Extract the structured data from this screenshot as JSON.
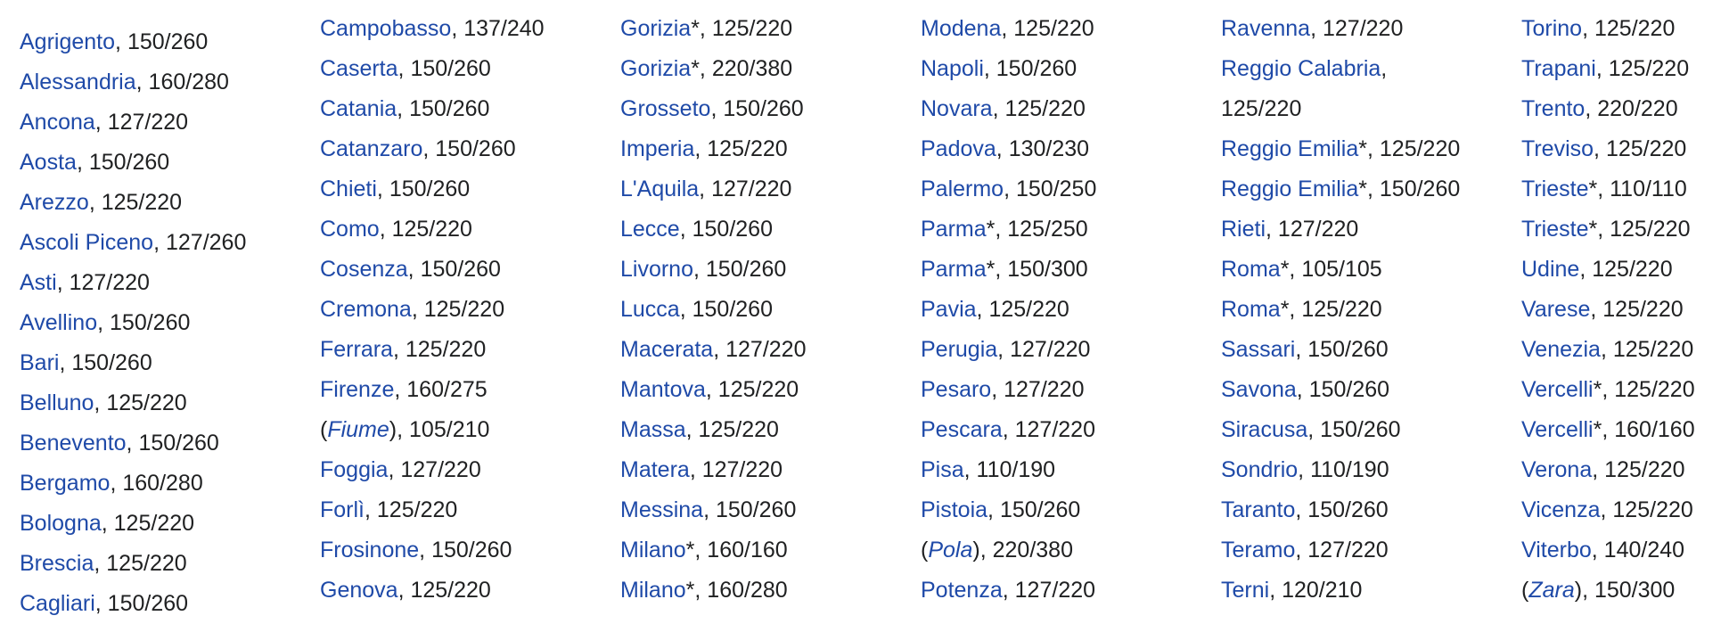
{
  "columns": [
    {
      "entries": [
        {
          "name": "Agrigento",
          "value": "150/260"
        },
        {
          "name": "Alessandria",
          "value": "160/280"
        },
        {
          "name": "Ancona",
          "value": "127/220"
        },
        {
          "name": "Aosta",
          "value": "150/260"
        },
        {
          "name": "Arezzo",
          "value": "125/220"
        },
        {
          "name": "Ascoli Piceno",
          "value": "127/260"
        },
        {
          "name": "Asti",
          "value": "127/220"
        },
        {
          "name": "Avellino",
          "value": "150/260"
        },
        {
          "name": "Bari",
          "value": "150/260"
        },
        {
          "name": "Belluno",
          "value": "125/220"
        },
        {
          "name": "Benevento",
          "value": "150/260"
        },
        {
          "name": "Bergamo",
          "value": "160/280"
        },
        {
          "name": "Bologna",
          "value": "125/220"
        },
        {
          "name": "Brescia",
          "value": "125/220"
        },
        {
          "name": "Cagliari",
          "value": "150/260"
        }
      ]
    },
    {
      "entries": [
        {
          "name": "Campobasso",
          "value": "137/240"
        },
        {
          "name": "Caserta",
          "value": "150/260"
        },
        {
          "name": "Catania",
          "value": "150/260"
        },
        {
          "name": "Catanzaro",
          "value": "150/260"
        },
        {
          "name": "Chieti",
          "value": "150/260"
        },
        {
          "name": "Como",
          "value": "125/220"
        },
        {
          "name": "Cosenza",
          "value": "150/260"
        },
        {
          "name": "Cremona",
          "value": "125/220"
        },
        {
          "name": "Ferrara",
          "value": "125/220"
        },
        {
          "name": "Firenze",
          "value": "160/275"
        },
        {
          "name": "Fiume",
          "value": "105/210",
          "italic": true
        },
        {
          "name": "Foggia",
          "value": "127/220"
        },
        {
          "name": "Forlì",
          "value": "125/220"
        },
        {
          "name": "Frosinone",
          "value": "150/260"
        },
        {
          "name": "Genova",
          "value": "125/220"
        }
      ]
    },
    {
      "entries": [
        {
          "name": "Gorizia",
          "value": "125/220",
          "star": true
        },
        {
          "name": "Gorizia",
          "value": "220/380",
          "star": true
        },
        {
          "name": "Grosseto",
          "value": "150/260"
        },
        {
          "name": "Imperia",
          "value": "125/220"
        },
        {
          "name": "L'Aquila",
          "value": "127/220"
        },
        {
          "name": "Lecce",
          "value": "150/260"
        },
        {
          "name": "Livorno",
          "value": "150/260"
        },
        {
          "name": "Lucca",
          "value": "150/260"
        },
        {
          "name": "Macerata",
          "value": "127/220"
        },
        {
          "name": "Mantova",
          "value": "125/220"
        },
        {
          "name": "Massa",
          "value": "125/220"
        },
        {
          "name": "Matera",
          "value": "127/220"
        },
        {
          "name": "Messina",
          "value": "150/260"
        },
        {
          "name": "Milano",
          "value": "160/160",
          "star": true
        },
        {
          "name": "Milano",
          "value": "160/280",
          "star": true
        }
      ]
    },
    {
      "entries": [
        {
          "name": "Modena",
          "value": "125/220"
        },
        {
          "name": "Napoli",
          "value": "150/260"
        },
        {
          "name": "Novara",
          "value": "125/220"
        },
        {
          "name": "Padova",
          "value": "130/230"
        },
        {
          "name": "Palermo",
          "value": "150/250"
        },
        {
          "name": "Parma",
          "value": "125/250",
          "star": true
        },
        {
          "name": "Parma",
          "value": "150/300",
          "star": true
        },
        {
          "name": "Pavia",
          "value": "125/220"
        },
        {
          "name": "Perugia",
          "value": "127/220"
        },
        {
          "name": "Pesaro",
          "value": "127/220"
        },
        {
          "name": "Pescara",
          "value": "127/220"
        },
        {
          "name": "Pisa",
          "value": "110/190"
        },
        {
          "name": "Pistoia",
          "value": "150/260"
        },
        {
          "name": "Pola",
          "value": "220/380",
          "italic": true
        },
        {
          "name": "Potenza",
          "value": "127/220"
        }
      ]
    },
    {
      "entries": [
        {
          "name": "Ravenna",
          "value": "127/220"
        },
        {
          "name": "Reggio Calabria",
          "value": "125/220",
          "wrap": true
        },
        {
          "name": "Reggio Emilia",
          "value": "125/220",
          "star": true
        },
        {
          "name": "Reggio Emilia",
          "value": "150/260",
          "star": true
        },
        {
          "name": "Rieti",
          "value": "127/220"
        },
        {
          "name": "Roma",
          "value": "105/105",
          "star": true
        },
        {
          "name": "Roma",
          "value": "125/220",
          "star": true
        },
        {
          "name": "Sassari",
          "value": "150/260"
        },
        {
          "name": "Savona",
          "value": "150/260"
        },
        {
          "name": "Siracusa",
          "value": "150/260"
        },
        {
          "name": "Sondrio",
          "value": "110/190"
        },
        {
          "name": "Taranto",
          "value": "150/260"
        },
        {
          "name": "Teramo",
          "value": "127/220"
        },
        {
          "name": "Terni",
          "value": "120/210"
        }
      ]
    },
    {
      "entries": [
        {
          "name": "Torino",
          "value": "125/220"
        },
        {
          "name": "Trapani",
          "value": "125/220"
        },
        {
          "name": "Trento",
          "value": "220/220"
        },
        {
          "name": "Treviso",
          "value": "125/220"
        },
        {
          "name": "Trieste",
          "value": "110/110",
          "star": true
        },
        {
          "name": "Trieste",
          "value": "125/220",
          "star": true
        },
        {
          "name": "Udine",
          "value": "125/220"
        },
        {
          "name": "Varese",
          "value": "125/220"
        },
        {
          "name": "Venezia",
          "value": "125/220"
        },
        {
          "name": "Vercelli",
          "value": "125/220",
          "star": true
        },
        {
          "name": "Vercelli",
          "value": "160/160",
          "star": true
        },
        {
          "name": "Verona",
          "value": "125/220"
        },
        {
          "name": "Vicenza",
          "value": "125/220"
        },
        {
          "name": "Viterbo",
          "value": "140/240"
        },
        {
          "name": "Zara",
          "value": "150/300",
          "italic": true
        }
      ]
    }
  ]
}
